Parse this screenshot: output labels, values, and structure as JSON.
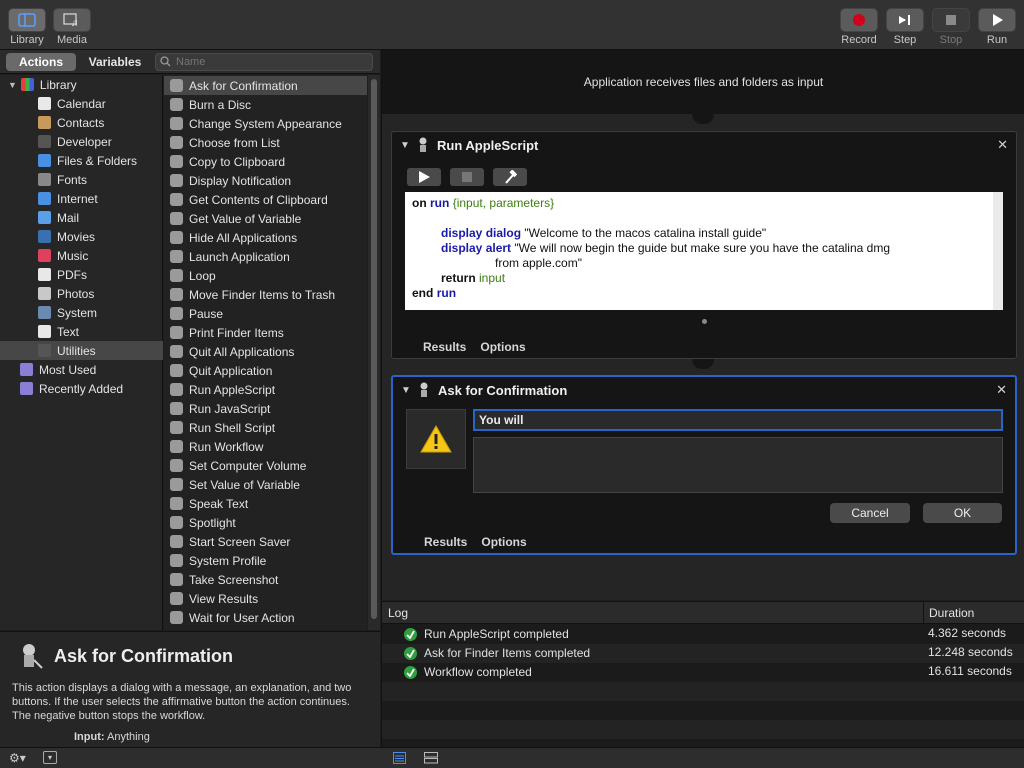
{
  "toolbar": {
    "library_label": "Library",
    "media_label": "Media",
    "record_label": "Record",
    "step_label": "Step",
    "stop_label": "Stop",
    "run_label": "Run"
  },
  "left_tabs": {
    "actions": "Actions",
    "variables": "Variables"
  },
  "search": {
    "placeholder": "Name"
  },
  "library": {
    "root": "Library",
    "items": [
      "Calendar",
      "Contacts",
      "Developer",
      "Files & Folders",
      "Fonts",
      "Internet",
      "Mail",
      "Movies",
      "Music",
      "PDFs",
      "Photos",
      "System",
      "Text",
      "Utilities"
    ],
    "selected": "Utilities",
    "most_used": "Most Used",
    "recently_added": "Recently Added"
  },
  "actions": {
    "items": [
      "Ask for Confirmation",
      "Burn a Disc",
      "Change System Appearance",
      "Choose from List",
      "Copy to Clipboard",
      "Display Notification",
      "Get Contents of Clipboard",
      "Get Value of Variable",
      "Hide All Applications",
      "Launch Application",
      "Loop",
      "Move Finder Items to Trash",
      "Pause",
      "Print Finder Items",
      "Quit All Applications",
      "Quit Application",
      "Run AppleScript",
      "Run JavaScript",
      "Run Shell Script",
      "Run Workflow",
      "Set Computer Volume",
      "Set Value of Variable",
      "Speak Text",
      "Spotlight",
      "Start Screen Saver",
      "System Profile",
      "Take Screenshot",
      "View Results",
      "Wait for User Action"
    ],
    "selected": "Ask for Confirmation"
  },
  "description": {
    "title": "Ask for Confirmation",
    "text": "This action displays a dialog with a message, an explanation, and two buttons. If the user selects the affirmative button the action continues. The negative button stops the workflow.",
    "input_label": "Input:",
    "input_value": "Anything"
  },
  "workflow": {
    "header": "Application receives files and folders as input",
    "card1": {
      "title": "Run AppleScript",
      "code": {
        "on": "on",
        "run": "run",
        "params": "{input, parameters}",
        "display": "display",
        "dialog": "dialog",
        "dialog_text": "\"Welcome to the macos catalina install guide\"",
        "alert": "alert",
        "alert_text": "\"We will now begin the guide but make sure you have the catalina dmg",
        "alert_text2": "from apple.com\"",
        "return": "return",
        "input": "input",
        "end": "end"
      },
      "tab_results": "Results",
      "tab_options": "Options"
    },
    "card2": {
      "title": "Ask for Confirmation",
      "message_value": "You will ",
      "cancel": "Cancel",
      "ok": "OK",
      "tab_results": "Results",
      "tab_options": "Options"
    }
  },
  "log": {
    "col_log": "Log",
    "col_duration": "Duration",
    "rows": [
      {
        "text": "Run AppleScript completed",
        "duration": "4.362 seconds"
      },
      {
        "text": "Ask for Finder Items completed",
        "duration": "12.248 seconds"
      },
      {
        "text": "Workflow completed",
        "duration": "16.611 seconds"
      }
    ]
  },
  "colors": {
    "accent": "#2a64c8",
    "success": "#2f9f3f",
    "record": "#d0021b"
  }
}
